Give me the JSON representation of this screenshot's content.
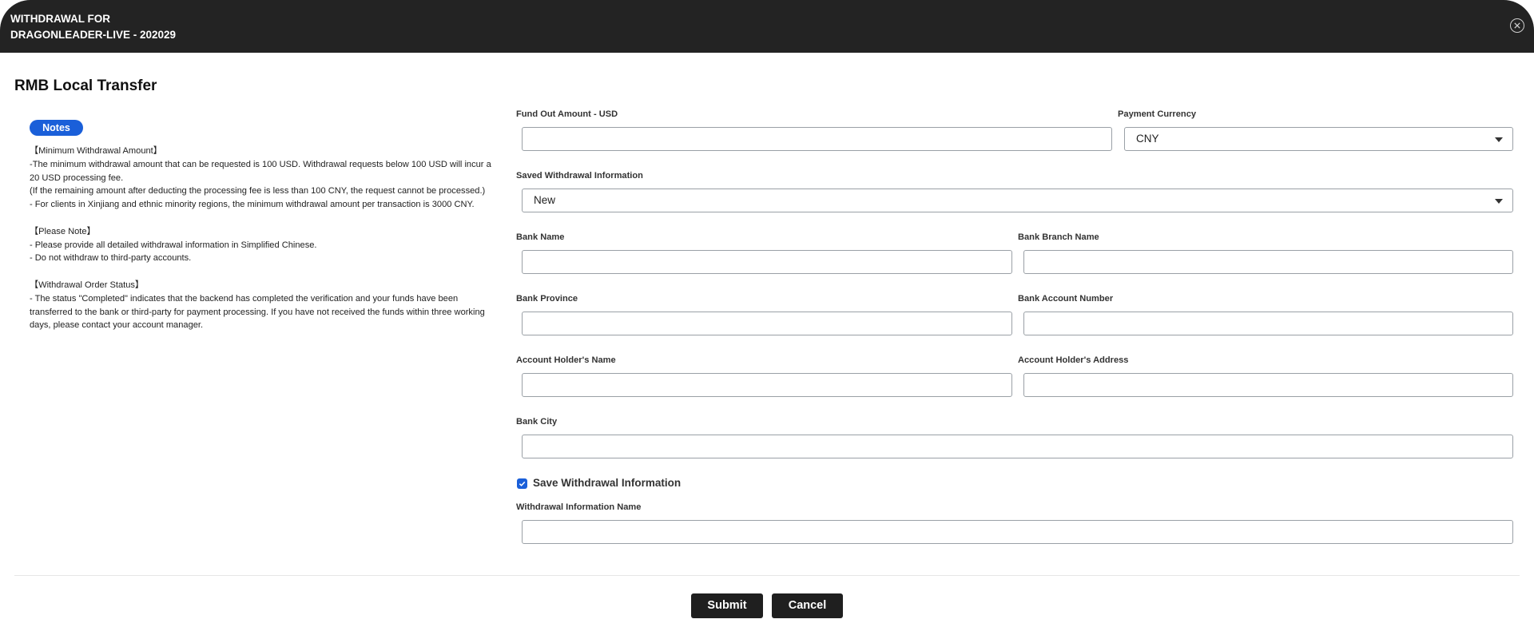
{
  "header": {
    "title_line1": "WITHDRAWAL FOR",
    "title_line2": "DRAGONLEADER-LIVE - 202029",
    "close_icon": "close-circle-icon"
  },
  "page_title": "RMB Local Transfer",
  "notes": {
    "badge": "Notes",
    "lines": [
      "【Minimum Withdrawal Amount】",
      "-The minimum withdrawal amount that can be requested is 100 USD. Withdrawal requests below 100 USD will incur a 20 USD processing fee.",
      "(If the remaining amount after deducting the processing fee is less than 100 CNY, the request cannot be processed.)",
      "- For clients in Xinjiang and ethnic minority regions, the minimum withdrawal amount per transaction is 3000 CNY.",
      "【Please Note】",
      "- Please provide all detailed withdrawal information in Simplified Chinese.",
      "- Do not withdraw to third-party accounts.",
      "【Withdrawal Order Status】",
      "- The status \"Completed\" indicates that the backend has completed the verification and your funds have been transferred to the bank or third-party for payment processing. If you have not received the funds within three working days, please contact your account manager."
    ]
  },
  "form": {
    "fund_out_amount": {
      "label": "Fund Out Amount - USD",
      "value": ""
    },
    "payment_currency": {
      "label": "Payment Currency",
      "selected": "CNY"
    },
    "saved_info": {
      "label": "Saved Withdrawal Information",
      "selected": "New"
    },
    "bank_name": {
      "label": "Bank Name",
      "value": ""
    },
    "bank_branch_name": {
      "label": "Bank Branch Name",
      "value": ""
    },
    "bank_province": {
      "label": "Bank Province",
      "value": ""
    },
    "bank_account_number": {
      "label": "Bank Account Number",
      "value": ""
    },
    "account_holder_name": {
      "label": "Account Holder's Name",
      "value": ""
    },
    "account_holder_address": {
      "label": "Account Holder's Address",
      "value": ""
    },
    "bank_city": {
      "label": "Bank City",
      "value": ""
    },
    "save_info_checkbox": {
      "label": "Save Withdrawal Information",
      "checked": true
    },
    "withdrawal_info_name": {
      "label": "Withdrawal Information Name",
      "value": ""
    }
  },
  "actions": {
    "submit": "Submit",
    "cancel": "Cancel"
  },
  "colors": {
    "header_bg": "#232323",
    "accent": "#1a5fd9",
    "button_bg": "#1f1f1f"
  }
}
